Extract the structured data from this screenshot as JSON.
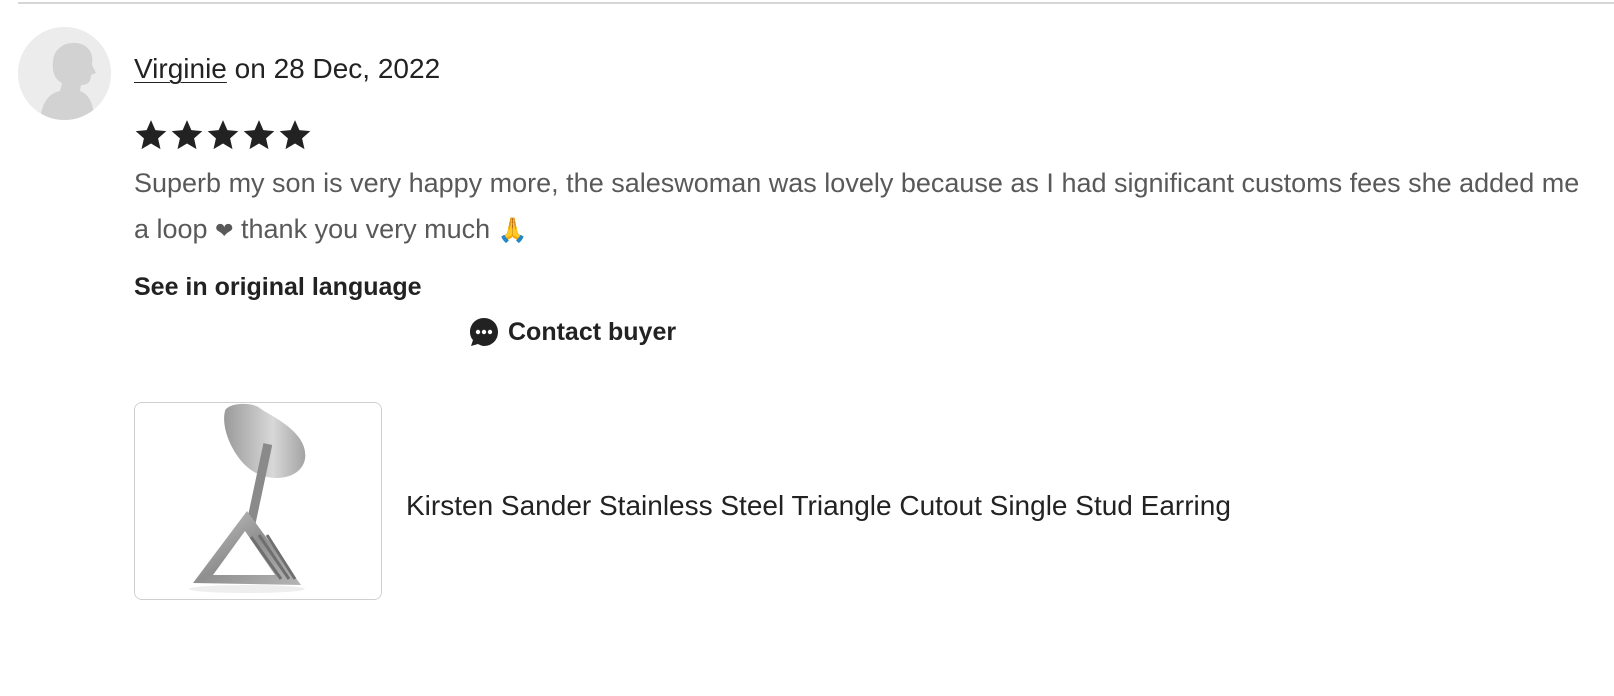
{
  "review": {
    "reviewer_name": "Virginie",
    "date_text": " on 28 Dec, 2022",
    "rating": 5,
    "rating_max": 5,
    "text_part1": "Superb my son is very happy more, the saleswoman was lovely because as I had significant customs fees she added me a loop ",
    "heart_glyph": "❤",
    "text_part2": " thank you very much ",
    "pray_glyph": "🙏",
    "see_original_label": "See in original language",
    "contact_buyer_label": "Contact buyer"
  },
  "product": {
    "title": "Kirsten Sander Stainless Steel Triangle Cutout Single Stud Earring"
  },
  "icons": {
    "avatar": "default-avatar-icon",
    "star": "star-icon",
    "contact": "chat-bubble-icon"
  },
  "colors": {
    "text_primary": "#222222",
    "text_secondary": "#595959",
    "star": "#222222",
    "divider": "#d6d6d6"
  }
}
